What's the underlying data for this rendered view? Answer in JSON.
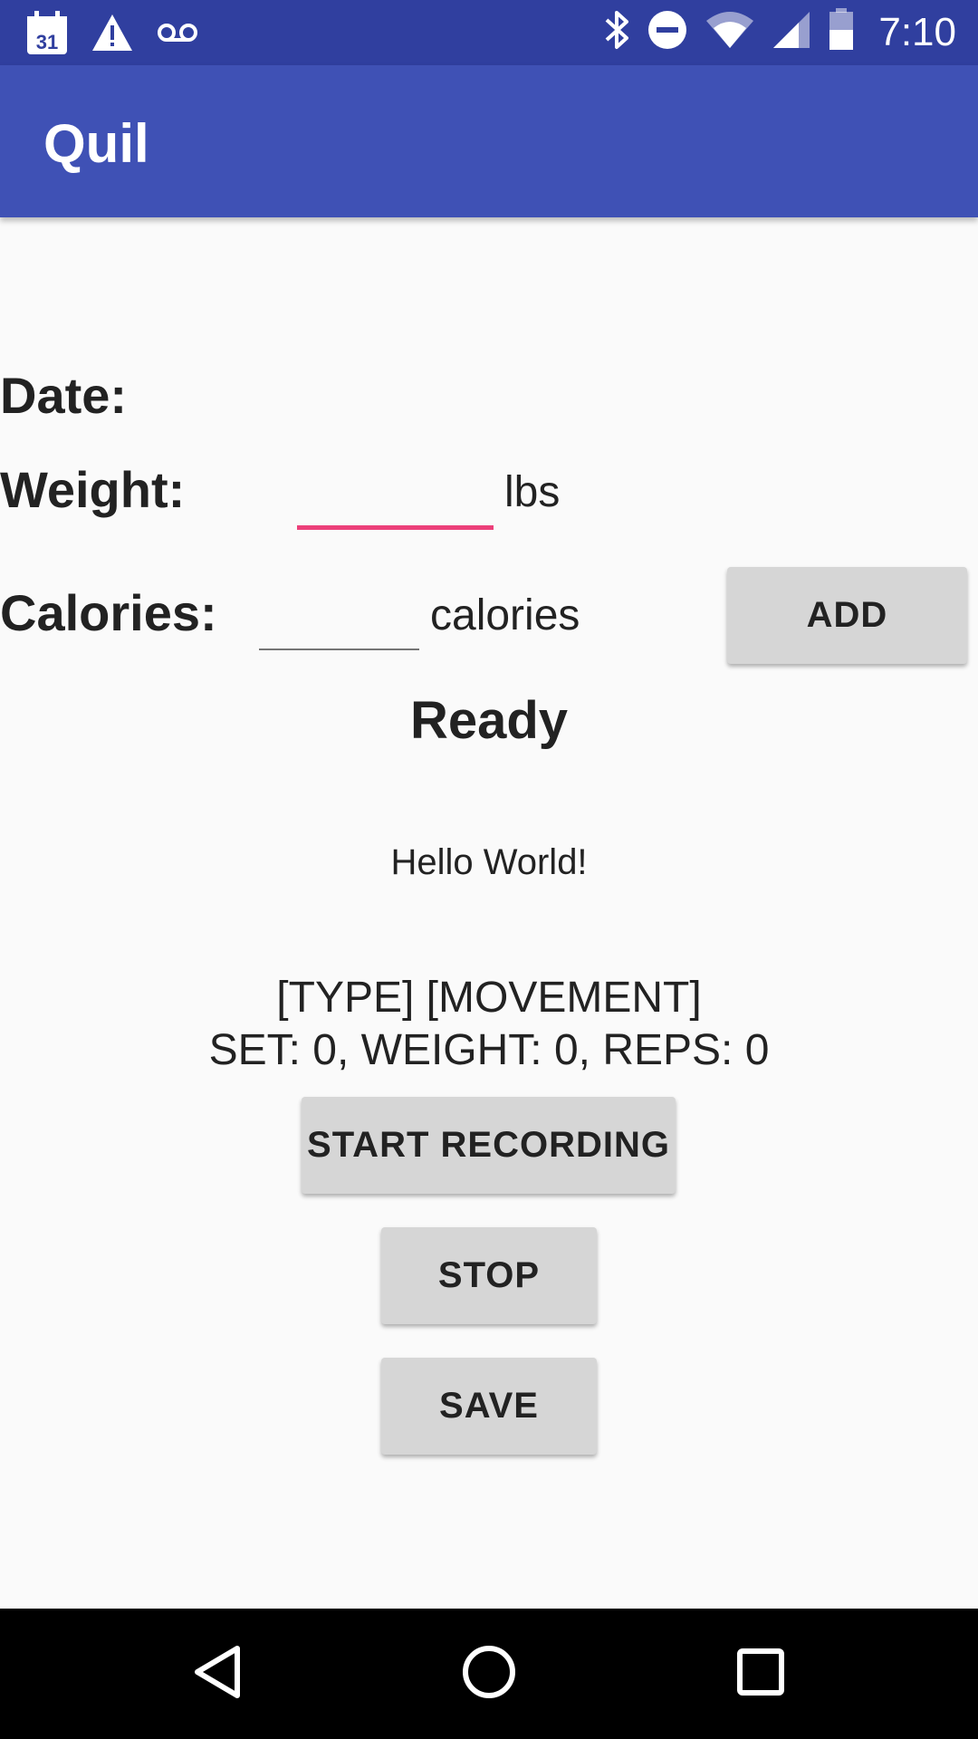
{
  "status_bar": {
    "time": "7:10",
    "left_icons": [
      "calendar-icon",
      "warning-icon",
      "voicemail-icon"
    ],
    "right_icons": [
      "bluetooth-icon",
      "do-not-disturb-icon",
      "wifi-icon",
      "cell-signal-icon",
      "battery-icon"
    ],
    "calendar_day": "31"
  },
  "app_bar": {
    "title": "Quil"
  },
  "form": {
    "date_label": "Date:",
    "weight_label": "Weight:",
    "weight_value": "",
    "weight_unit": "lbs",
    "calories_label": "Calories:",
    "calories_value": "",
    "calories_unit": "calories",
    "add_button": "ADD"
  },
  "status": {
    "state": "Ready",
    "message": "Hello World!",
    "movement": "[TYPE] [MOVEMENT]",
    "set_info": "SET: 0, WEIGHT: 0, REPS: 0"
  },
  "actions": {
    "start_recording": "START RECORDING",
    "stop": "STOP",
    "save": "SAVE"
  },
  "colors": {
    "status_bar": "#303f9f",
    "app_bar": "#3f51b5",
    "accent": "#ec407a",
    "button": "#d6d6d6"
  },
  "nav_bar": {
    "buttons": [
      "back-icon",
      "home-icon",
      "recents-icon"
    ]
  }
}
